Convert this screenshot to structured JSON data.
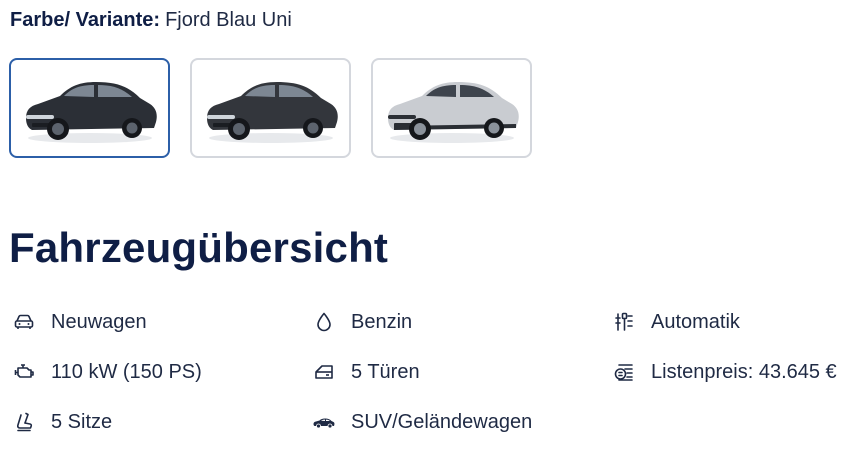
{
  "variant": {
    "label": "Farbe/ Variante:",
    "value": "Fjord Blau Uni"
  },
  "swatches": [
    {
      "name": "car-variant-1",
      "body_color": "#2b2f36",
      "selected": true
    },
    {
      "name": "car-variant-2",
      "body_color": "#33363c",
      "selected": false
    },
    {
      "name": "car-variant-3",
      "body_color": "#c9ccd1",
      "selected": false
    }
  ],
  "overview": {
    "title": "Fahrzeugübersicht",
    "specs": [
      {
        "icon": "car-icon",
        "text": "Neuwagen"
      },
      {
        "icon": "fuel-drop-icon",
        "text": "Benzin"
      },
      {
        "icon": "gearshift-icon",
        "text": "Automatik"
      },
      {
        "icon": "engine-icon",
        "text": "110 kW (150 PS)"
      },
      {
        "icon": "car-door-icon",
        "text": "5 Türen"
      },
      {
        "icon": "price-tag-icon",
        "text": "Listenpreis: 43.645 €"
      },
      {
        "icon": "car-seat-icon",
        "text": "5 Sitze"
      },
      {
        "icon": "suv-icon",
        "text": "SUV/Geländewagen"
      }
    ]
  },
  "colors": {
    "heading": "#0f1e45",
    "text": "#1f2a44",
    "selected_border": "#2c5fa8",
    "border": "#d4d7dd"
  }
}
